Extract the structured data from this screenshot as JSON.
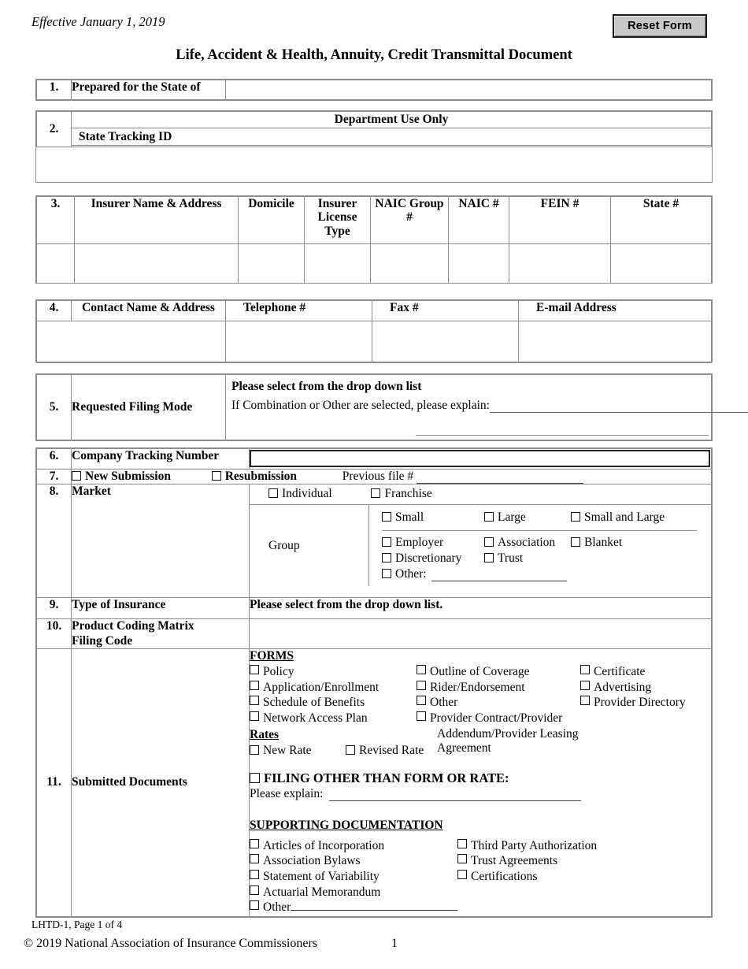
{
  "header": {
    "effective_date": "Effective January 1, 2019",
    "reset_button": "Reset Form",
    "title": "Life, Accident & Health, Annuity, Credit Transmittal Document"
  },
  "sections": {
    "s1": {
      "num": "1.",
      "label": "Prepared for the State of",
      "value": ""
    },
    "s2": {
      "num": "2.",
      "dept_header": "Department Use Only",
      "tracking_label": "State Tracking ID",
      "value": ""
    },
    "s3": {
      "num": "3.",
      "columns": [
        "Insurer Name & Address",
        "Domicile",
        "Insurer License Type",
        "NAIC Group #",
        "NAIC #",
        "FEIN #",
        "State #"
      ],
      "row": [
        "",
        "",
        "",
        "",
        "",
        "",
        ""
      ]
    },
    "s4": {
      "num": "4.",
      "columns": [
        "Contact Name & Address",
        "Telephone #",
        "Fax #",
        "E-mail Address"
      ],
      "row": [
        "",
        "",
        "",
        ""
      ]
    },
    "s5": {
      "num": "5.",
      "label": "Requested Filing Mode",
      "dropdown_prompt": "Please select from the drop down list",
      "explain_prompt": "If Combination or Other are selected, please explain:",
      "explain_value": ""
    },
    "s6": {
      "num": "6.",
      "label": "Company Tracking Number",
      "value": ""
    },
    "s7": {
      "num": "7.",
      "new_submission": "New Submission",
      "resubmission": "Resubmission",
      "previous_file_label": "Previous file #",
      "previous_file_value": ""
    },
    "s8": {
      "num": "8.",
      "label": "Market",
      "individual": "Individual",
      "franchise": "Franchise",
      "group_label": "Group",
      "size_options": [
        "Small",
        "Large",
        "Small and Large"
      ],
      "type_options": [
        "Employer",
        "Association",
        "Blanket",
        "Discretionary",
        "Trust"
      ],
      "other_label": "Other:",
      "other_value": ""
    },
    "s9": {
      "num": "9.",
      "label": "Type of Insurance",
      "value": "Please select from the drop down list."
    },
    "s10": {
      "num": "10.",
      "label_line1": "Product Coding Matrix",
      "label_line2": "Filing Code",
      "value": ""
    },
    "s11": {
      "num": "11.",
      "label": "Submitted Documents",
      "forms_heading": "FORMS",
      "forms_col_a": [
        "Policy",
        "Application/Enrollment",
        "Schedule of Benefits",
        "Network Access Plan"
      ],
      "forms_col_b": [
        "Outline of Coverage",
        "Rider/Endorsement",
        "Other",
        "Provider Contract/Provider"
      ],
      "forms_col_b_cont_1": "Addendum/Provider Leasing",
      "forms_col_b_cont_2": "Agreement",
      "forms_col_c": [
        "Certificate",
        "Advertising",
        "Provider Directory"
      ],
      "rates_heading": "Rates",
      "rates_options": [
        "New Rate",
        "Revised Rate"
      ],
      "filing_other_label": "FILING OTHER THAN FORM OR RATE:",
      "please_explain_label": "Please explain:",
      "please_explain_value": "",
      "supporting_heading": "SUPPORTING DOCUMENTATION",
      "supporting_col_a": [
        "Articles of Incorporation",
        "Association Bylaws",
        "Statement of Variability",
        "Actuarial Memorandum"
      ],
      "supporting_other_label": "Other",
      "supporting_other_value": "",
      "supporting_col_b": [
        "Third Party Authorization",
        "Trust Agreements",
        "Certifications"
      ]
    }
  },
  "footer": {
    "form_id": "LHTD-1, Page 1 of 4",
    "copyright": "© 2019 National Association of Insurance Commissioners",
    "page_number": "1"
  }
}
